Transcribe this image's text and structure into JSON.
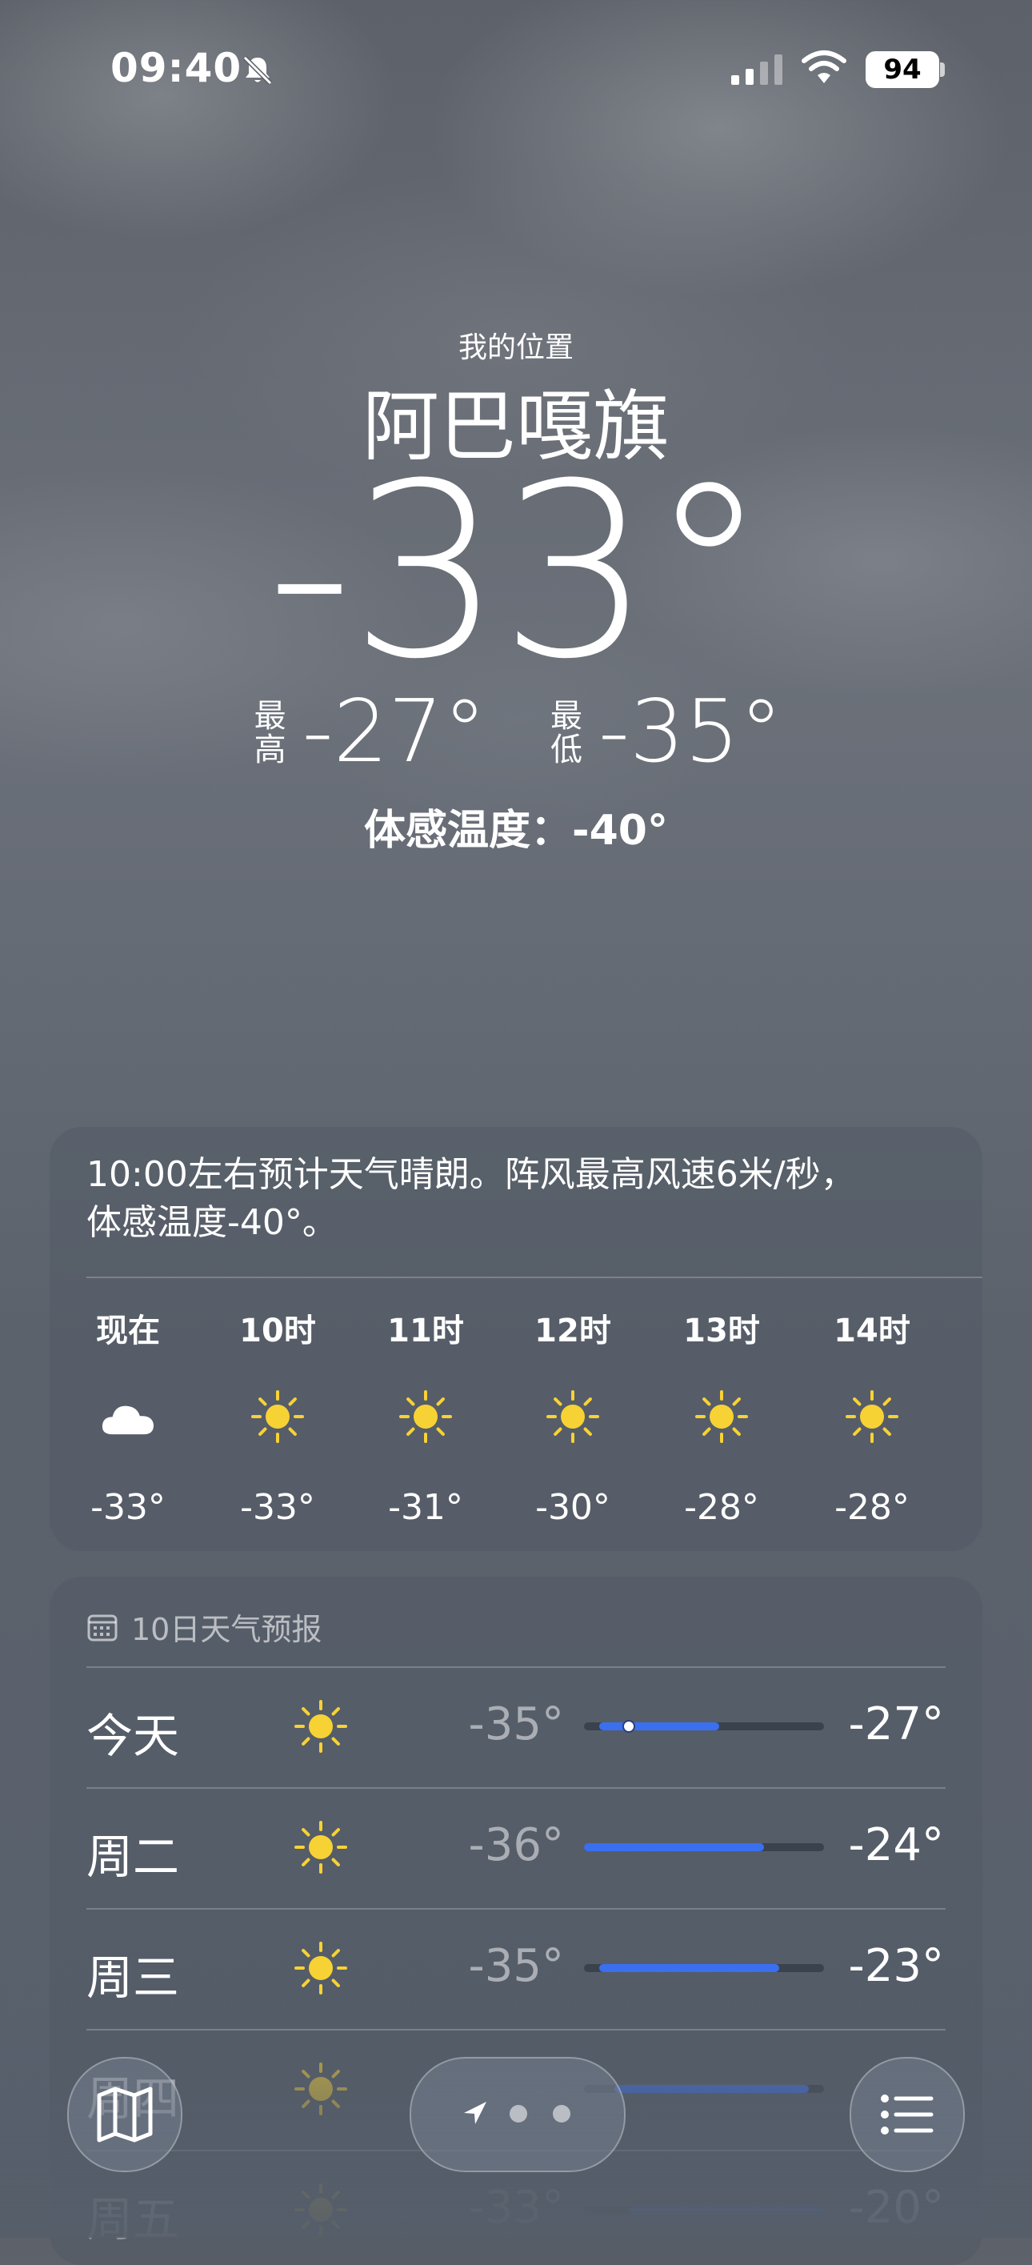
{
  "status_bar": {
    "time": "09:40",
    "battery": "94",
    "icons": [
      "bell-slash-icon",
      "cellular-signal-icon",
      "wifi-icon",
      "battery-icon"
    ]
  },
  "location": {
    "label": "我的位置",
    "city": "阿巴嘎旗",
    "temperature": "-33°",
    "high_label": "最高",
    "high": "-27°",
    "low_label": "最低",
    "low": "-35°",
    "feels_like": "体感温度：-40°"
  },
  "hourly": {
    "summary_line1": "10:00左右预计天气晴朗。阵风最高风速6米/秒，",
    "summary_line2": "体感温度-40°。",
    "hours": [
      {
        "label": "现在",
        "icon": "cloud-icon",
        "temp": "-33°"
      },
      {
        "label": "10时",
        "icon": "sun-icon",
        "temp": "-33°"
      },
      {
        "label": "11时",
        "icon": "sun-icon",
        "temp": "-31°"
      },
      {
        "label": "12时",
        "icon": "sun-icon",
        "temp": "-30°"
      },
      {
        "label": "13时",
        "icon": "sun-icon",
        "temp": "-28°"
      },
      {
        "label": "14时",
        "icon": "sun-icon",
        "temp": "-28°"
      }
    ]
  },
  "daily": {
    "title": "10日天气预报",
    "range_min": -36,
    "range_max": -20,
    "days": [
      {
        "day": "今天",
        "icon": "sun-icon",
        "low": "-35°",
        "high": "-27°",
        "low_val": -35,
        "high_val": -27,
        "current_val": -33
      },
      {
        "day": "周二",
        "icon": "sun-icon",
        "low": "-36°",
        "high": "-24°",
        "low_val": -36,
        "high_val": -24
      },
      {
        "day": "周三",
        "icon": "sun-icon",
        "low": "-35°",
        "high": "-23°",
        "low_val": -35,
        "high_val": -23
      },
      {
        "day": "周四",
        "icon": "sun-icon",
        "low": "",
        "high": "",
        "low_val": -34,
        "high_val": -21
      },
      {
        "day": "周五",
        "icon": "sun-icon",
        "low": "-33°",
        "high": "-20°",
        "low_val": -33,
        "high_val": -20
      }
    ]
  },
  "colors": {
    "sun": "#f7d234",
    "bar_fill": "#3a6ff0"
  },
  "bottom_bar": {
    "map_icon": "map-icon",
    "location_icon": "location-arrow-icon",
    "list_icon": "list-icon",
    "page_count": 3
  }
}
